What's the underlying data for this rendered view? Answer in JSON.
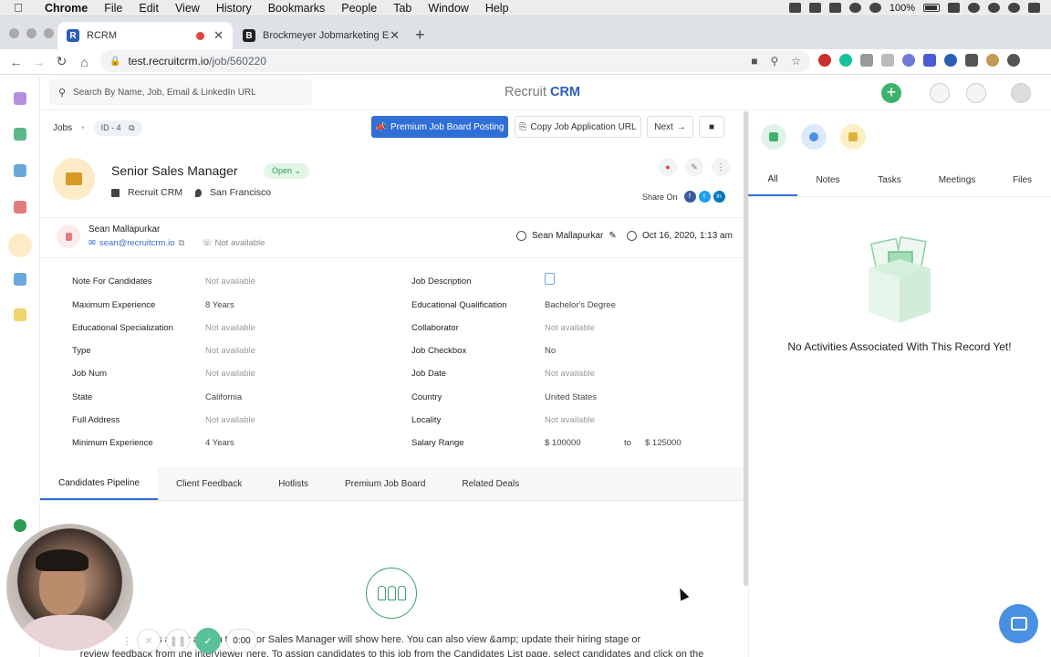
{
  "menubar": {
    "app": "Chrome",
    "items": [
      "File",
      "Edit",
      "View",
      "History",
      "Bookmarks",
      "People",
      "Tab",
      "Window",
      "Help"
    ],
    "battery": "100%"
  },
  "browser": {
    "tabs": [
      {
        "favicon": "R",
        "title": "RCRM",
        "favicon_color": "#2b5fb5"
      },
      {
        "favicon": "B",
        "title": "Brockmeyer Jobmarketing Exp",
        "favicon_color": "#222222"
      }
    ],
    "url_host": "test.recruitcrm.io",
    "url_path": "/job/560220"
  },
  "app": {
    "search_placeholder": "Search By Name, Job, Email & LinkedIn URL",
    "brand_prefix": "Recruit",
    "brand_suffix": "CRM",
    "brand_color": "#2b5fb5"
  },
  "job": {
    "breadcrumb": "Jobs",
    "id": "ID - 4",
    "premium_button": "Premium Job Board Posting",
    "copy_button": "Copy Job Application URL",
    "next_button": "Next",
    "title": "Senior Sales Manager",
    "status": "Open",
    "company": "Recruit CRM",
    "location": "San Francisco",
    "share_label": "Share On",
    "owner_name": "Sean Mallapurkar",
    "owner_email": "sean@recruitcrm.io",
    "owner_phone": "Not available",
    "created_by": "Sean Mallapurkar",
    "created_at": "Oct 16, 2020, 1:13 am"
  },
  "details": {
    "left": [
      {
        "label": "Note For Candidates",
        "value": "Not available"
      },
      {
        "label": "Maximum Experience",
        "value": "8 Years"
      },
      {
        "label": "Educational Specialization",
        "value": "Not available"
      },
      {
        "label": "Type",
        "value": "Not available"
      },
      {
        "label": "Job Num",
        "value": "Not available"
      },
      {
        "label": "State",
        "value": "California"
      },
      {
        "label": "Full Address",
        "value": "Not available"
      },
      {
        "label": "Minimum Experience",
        "value": "4 Years"
      }
    ],
    "right": [
      {
        "label": "Job Description",
        "value": ""
      },
      {
        "label": "Educational Qualification",
        "value": "Bachelor's Degree"
      },
      {
        "label": "Collaborator",
        "value": "Not available"
      },
      {
        "label": "Job Checkbox",
        "value": "No"
      },
      {
        "label": "Job Date",
        "value": "Not available"
      },
      {
        "label": "Country",
        "value": "United States"
      },
      {
        "label": "Locality",
        "value": "Not available"
      }
    ],
    "salary_label": "Salary Range",
    "salary_from": "$ 100000",
    "salary_to_label": "to",
    "salary_to": "$ 125000"
  },
  "bottom_tabs": [
    "Candidates Pipeline",
    "Client Feedback",
    "Hotlists",
    "Premium Job Board",
    "Related Deals"
  ],
  "pipeline_text_line1": "ates   at   ...   r   assign to Senior Sales Manager will show here. You can also view &amp; update their hiring stage or",
  "pipeline_text_line2": "review feedback from the interviewer here. To assign candidates to this job from the Candidates List page, select candidates and click on the",
  "right_panel": {
    "tabs": [
      "All",
      "Notes",
      "Tasks",
      "Meetings",
      "Files"
    ],
    "empty_text": "No Activities Associated With This Record Yet!"
  },
  "recorder": {
    "time": "0:00"
  }
}
